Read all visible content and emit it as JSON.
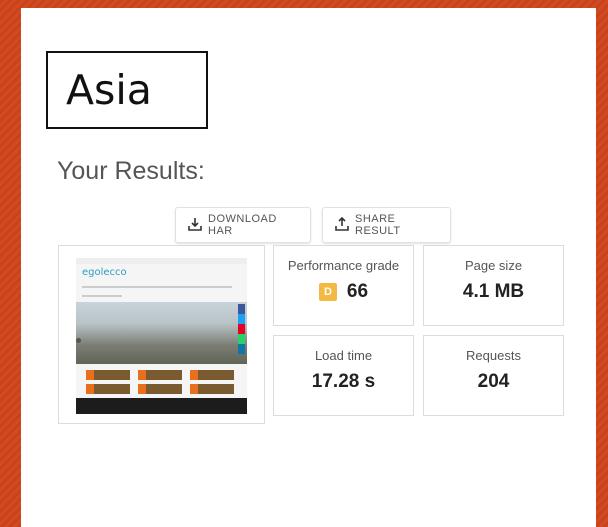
{
  "region": {
    "label": "Asia"
  },
  "results": {
    "title": "Your Results:"
  },
  "actions": {
    "download_har": "DOWNLOAD HAR",
    "share_result": "SHARE RESULT"
  },
  "metrics": {
    "performance": {
      "label": "Performance grade",
      "grade": "D",
      "score": "66",
      "grade_color": "#f4b942"
    },
    "page_size": {
      "label": "Page size",
      "value": "4.1 MB"
    },
    "load_time": {
      "label": "Load time",
      "value": "17.28 s"
    },
    "requests": {
      "label": "Requests",
      "value": "204"
    }
  },
  "screenshot": {
    "site_logo": "egolecco"
  },
  "colors": {
    "background": "#c9421c",
    "card": "#ffffff"
  }
}
